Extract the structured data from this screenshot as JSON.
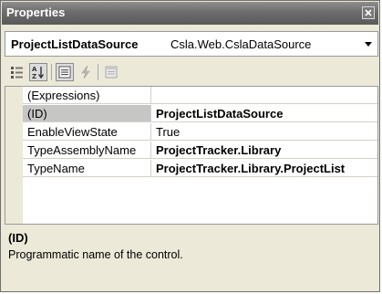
{
  "window": {
    "title": "Properties"
  },
  "object_selector": {
    "name": "ProjectListDataSource",
    "type": "Csla.Web.CslaDataSource"
  },
  "toolbar": {
    "buttons": [
      {
        "icon": "categorized-icon",
        "pressed": false
      },
      {
        "icon": "alphabetical-icon",
        "pressed": true
      },
      {
        "icon": "properties-icon",
        "pressed": true
      },
      {
        "icon": "events-icon",
        "pressed": false
      },
      {
        "icon": "property-pages-icon",
        "pressed": false
      }
    ]
  },
  "grid": {
    "rows": [
      {
        "name": "(Expressions)",
        "value": "",
        "bold": false,
        "selected": false
      },
      {
        "name": "(ID)",
        "value": "ProjectListDataSource",
        "bold": true,
        "selected": true
      },
      {
        "name": "EnableViewState",
        "value": "True",
        "bold": false,
        "selected": false
      },
      {
        "name": "TypeAssemblyName",
        "value": "ProjectTracker.Library",
        "bold": true,
        "selected": false
      },
      {
        "name": "TypeName",
        "value": "ProjectTracker.Library.ProjectList",
        "bold": true,
        "selected": false
      }
    ]
  },
  "description": {
    "title": "(ID)",
    "text": "Programmatic name of the control."
  }
}
